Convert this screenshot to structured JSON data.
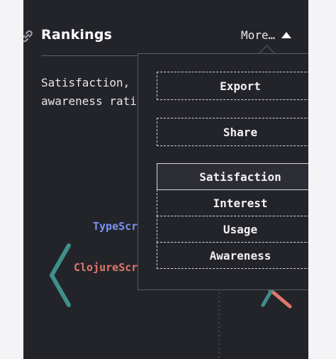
{
  "header": {
    "title": "Rankings",
    "more_label": "More…",
    "link_icon": "link-icon",
    "more_icon": "triangle-up-icon"
  },
  "description": {
    "line1": "Satisfaction,",
    "line2": "awareness rati"
  },
  "chart": {
    "labels": {
      "typescript": "TypeScr",
      "clojurescript": "ClojureScr"
    }
  },
  "dropdown": {
    "export_label": "Export",
    "share_label": "Share",
    "ranking_options": [
      {
        "label": "Satisfaction",
        "selected": true
      },
      {
        "label": "Interest",
        "selected": false
      },
      {
        "label": "Usage",
        "selected": false
      },
      {
        "label": "Awareness",
        "selected": false
      }
    ]
  },
  "colors": {
    "panel_bg": "#23242a",
    "typescript": "#7b93f0",
    "clojurescript": "#e0776a",
    "teal_line": "#3f8f8c"
  }
}
